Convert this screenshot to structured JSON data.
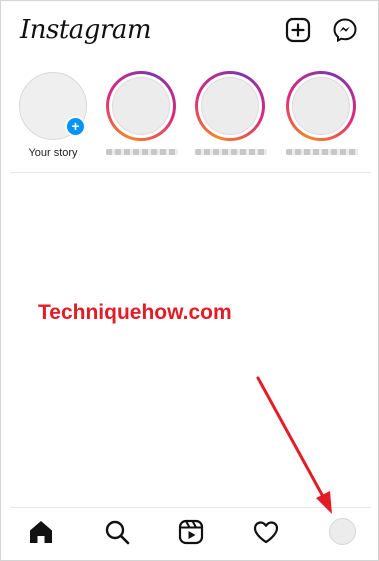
{
  "app": {
    "title": "Instagram"
  },
  "header": {
    "new_post_icon": "plus-square-icon",
    "messenger_icon": "messenger-icon"
  },
  "stories": [
    {
      "label": "Your story",
      "own": true
    },
    {
      "label": "",
      "own": false
    },
    {
      "label": "",
      "own": false
    },
    {
      "label": "",
      "own": false
    }
  ],
  "watermark": "Techniquehow.com",
  "nav": {
    "items": [
      "home-icon",
      "search-icon",
      "reels-icon",
      "heart-icon",
      "profile-avatar"
    ]
  },
  "colors": {
    "accent": "#0095f6",
    "annotation": "#e31c25"
  }
}
